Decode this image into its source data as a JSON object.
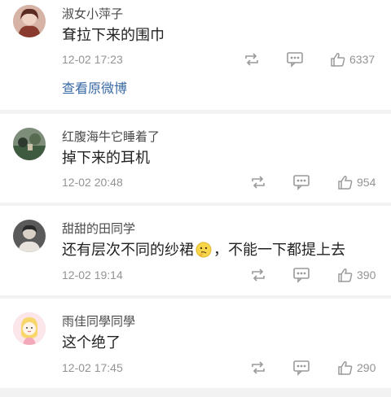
{
  "comments": [
    {
      "username": "淑女小萍子",
      "text": "耷拉下来的围巾",
      "time": "12-02 17:23",
      "likes": "6337",
      "link": "查看原微博",
      "avatar_color": "#c98a7a"
    },
    {
      "username": "红腹海牛它睡着了",
      "text": "掉下来的耳机",
      "time": "12-02 20:48",
      "likes": "954",
      "avatar_color": "#4d6a55"
    },
    {
      "username": "甜甜的田同学",
      "text_before": "还有层次不同的纱裙",
      "text_after": "，不能一下都提上去",
      "time": "12-02 19:14",
      "likes": "390",
      "avatar_color": "#6b6b6b"
    },
    {
      "username": "雨佳同學同學",
      "text": "这个绝了",
      "time": "12-02 17:45",
      "likes": "290",
      "avatar_color": "#fde6ea"
    }
  ],
  "icons": {
    "repost": "repost-icon",
    "comment": "comment-icon",
    "like": "thumbs-up-icon",
    "emoji": "thinking-emoji"
  },
  "colors": {
    "link": "#3a6aa5",
    "text": "#222222",
    "meta": "#939393",
    "background": "#f2f2f2"
  }
}
